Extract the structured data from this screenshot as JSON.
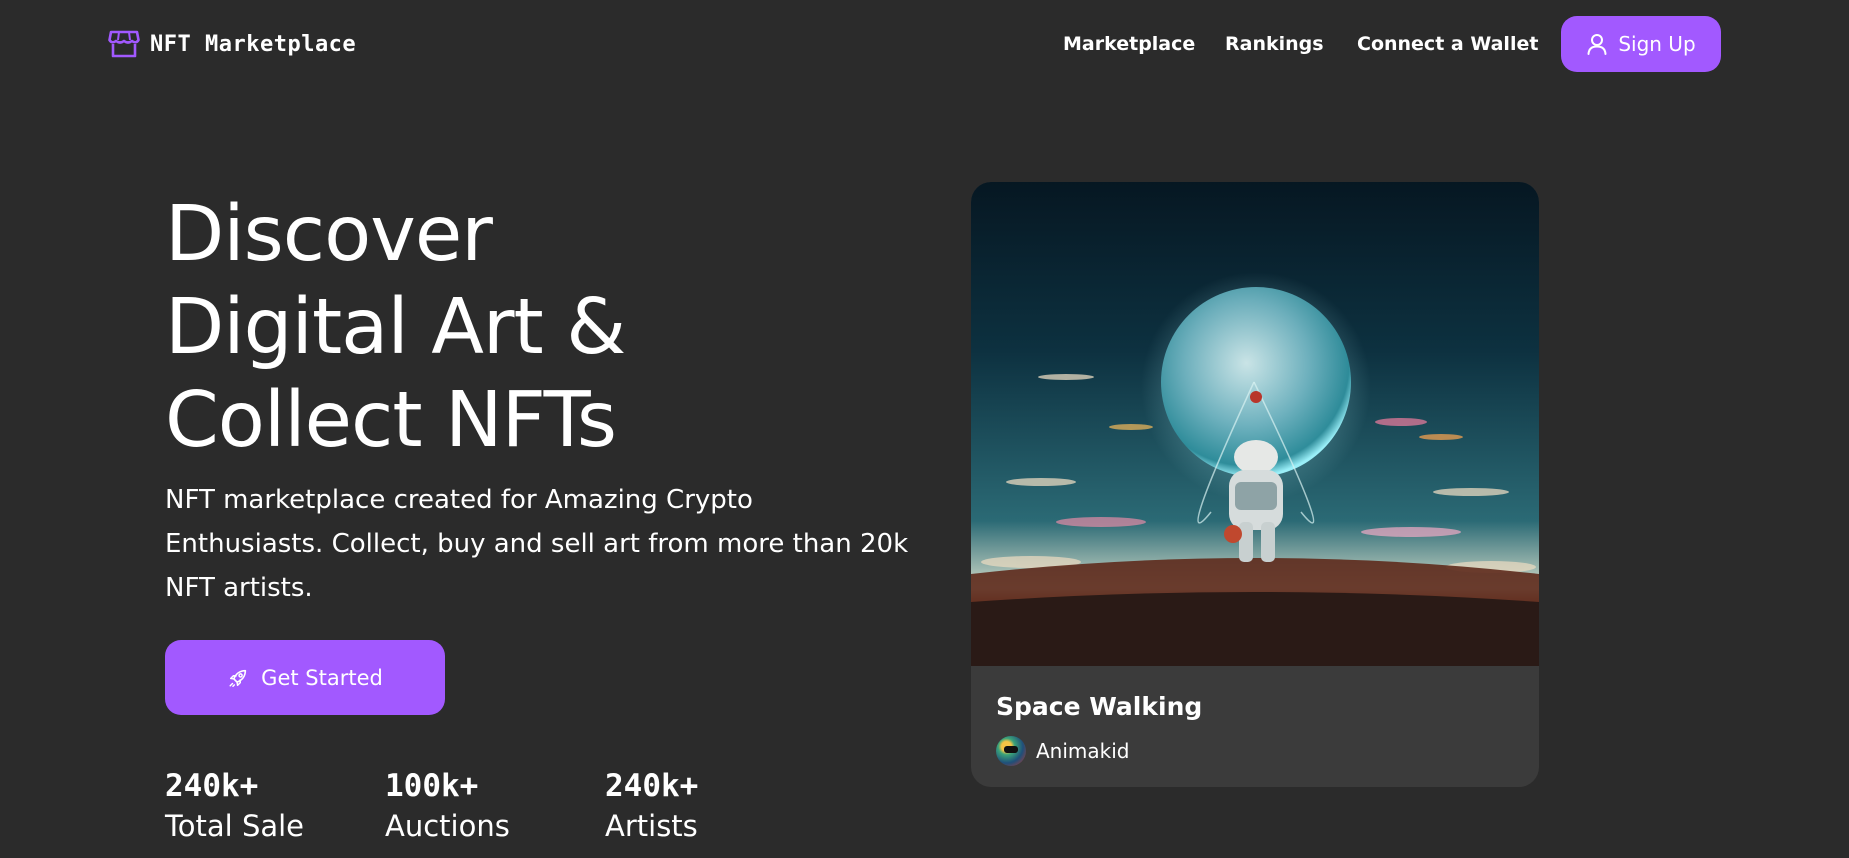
{
  "header": {
    "logo_text": "NFT Marketplace",
    "logo_icon": "storefront-icon",
    "nav": [
      "Marketplace",
      "Rankings",
      "Connect a Wallet"
    ],
    "signup_label": "Sign Up",
    "signup_icon": "user-icon"
  },
  "hero": {
    "title_lines": [
      "Discover",
      "Digital Art &",
      "Collect NFTs"
    ],
    "description_lines": [
      "NFT marketplace created for Amazing Crypto",
      "Enthusiasts. Collect, buy and sell art from more than 20k",
      "NFT artists."
    ],
    "cta_label": "Get Started",
    "cta_icon": "rocket-icon"
  },
  "stats": [
    {
      "value": "240k+",
      "label": "Total Sale"
    },
    {
      "value": "100k+",
      "label": "Auctions"
    },
    {
      "value": "240k+",
      "label": "Artists"
    }
  ],
  "featured": {
    "title": "Space Walking",
    "artist": "Animakid",
    "artist_icon": "avatar-icon"
  },
  "colors": {
    "background": "#2b2b2b",
    "accent": "#a259ff",
    "card": "#3b3b3b",
    "text": "#ffffff"
  }
}
